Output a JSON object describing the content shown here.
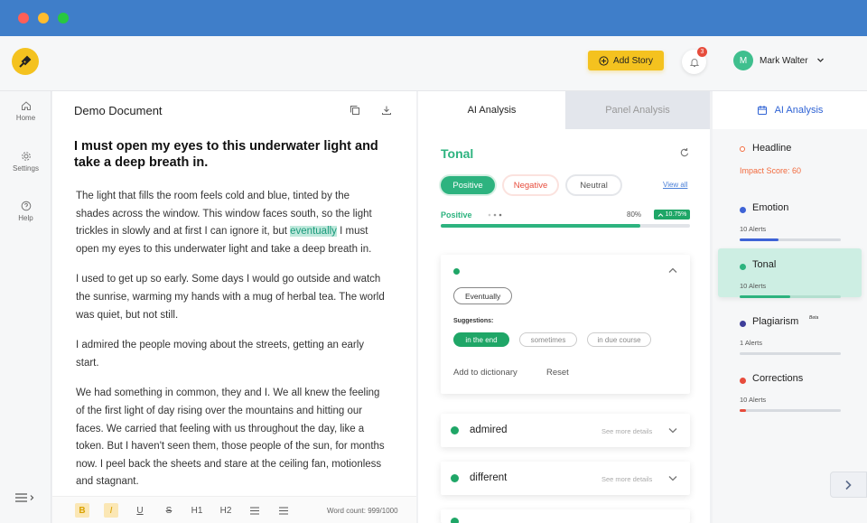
{
  "window": {
    "dots": [
      "#ff5f57",
      "#febc2e",
      "#28c840"
    ]
  },
  "header": {
    "add_story_label": "Add Story",
    "notification_count": "3",
    "user": {
      "initial": "M",
      "name": "Mark Walter"
    }
  },
  "sidenav": {
    "items": [
      {
        "label": "Home",
        "icon": "home-icon"
      },
      {
        "label": "Settings",
        "icon": "gear-icon"
      },
      {
        "label": "Help",
        "icon": "help-icon"
      }
    ]
  },
  "editor": {
    "title": "Demo Document",
    "heading": "I must open my eyes to this underwater light and take a deep breath in.",
    "paragraph1_before": "The light that fills the room feels cold and blue, tinted by the shades across the window. This window faces south, so the light trickles in slowly and at first I can ignore it, but ",
    "paragraph1_highlight": "eventually",
    "paragraph1_after": " I must open my eyes to this underwater light and take a deep breath in.",
    "paragraphs": [
      "I used to get up so early. Some days I would go outside and watch the sunrise, warming my hands with a mug of herbal tea. The world was quiet, but not still.",
      "I admired the people moving about the streets, getting an early start.",
      "We had something in common, they and I. We all knew the feeling of the first light of day rising over the mountains and hitting our faces. We carried that feeling with us throughout the day, like a token. But I haven't seen them, those people of the sun, for months now. I peel back the sheets and stare at the ceiling fan, motionless and stagnant."
    ],
    "toolbar": {
      "h1": "H1",
      "h2": "H2",
      "word_count": "Word count: 999/1000"
    }
  },
  "analysis": {
    "tabs": [
      "AI Analysis",
      "Panel Analysis"
    ],
    "section_title": "Tonal",
    "filters": [
      "Positive",
      "Negative",
      "Neutral"
    ],
    "view_all": "View all",
    "metric": {
      "label": "Positive",
      "percent_text": "80%",
      "change": "10.75%",
      "fraction": 0.8
    },
    "suggestion_card": {
      "word": "Eventually",
      "suggestions_label": "Suggestions:",
      "suggestions": [
        "in the end",
        "sometimes",
        "in due course"
      ],
      "add_to_dictionary": "Add to dictionary",
      "reset": "Reset"
    },
    "words": [
      {
        "word": "admired",
        "details": "See more details"
      },
      {
        "word": "different",
        "details": "See more details"
      }
    ]
  },
  "right_panel": {
    "title": "AI Analysis",
    "headline": {
      "label": "Headline",
      "impact": "Impact Score: 60",
      "color": "#f26a3d"
    },
    "categories": [
      {
        "label": "Emotion",
        "alerts": "10 Alerts",
        "color": "#3e63d6",
        "fill": 0.38
      },
      {
        "label": "Tonal",
        "alerts": "10 Alerts",
        "color": "#2db37f",
        "fill": 0.5
      },
      {
        "label": "Plagiarism",
        "beta": "Beta",
        "alerts": "1 Alerts",
        "color": "#3e3e9a",
        "fill": 0.0
      },
      {
        "label": "Corrections",
        "alerts": "10 Alerts",
        "color": "#e74c3c",
        "fill": 0.06
      }
    ]
  }
}
